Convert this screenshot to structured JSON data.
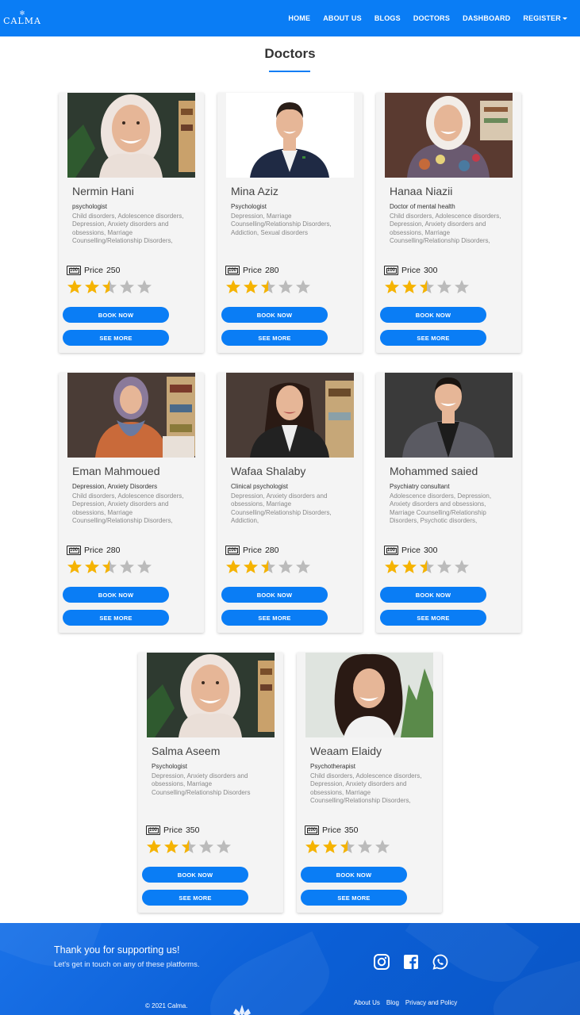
{
  "brand": {
    "name": "CALMA"
  },
  "nav": {
    "items": [
      {
        "label": "HOME"
      },
      {
        "label": "ABOUT US"
      },
      {
        "label": "BLOGS"
      },
      {
        "label": "DOCTORS"
      },
      {
        "label": "DASHBOARD"
      },
      {
        "label": "REGISTER"
      }
    ]
  },
  "page": {
    "title": "Doctors"
  },
  "labels": {
    "book_now": "BOOK NOW",
    "see_more": "SEE MORE",
    "price_prefix": "Price",
    "money_icon_text": "100"
  },
  "doctors": [
    {
      "name": "Nermin Hani",
      "title": "psychologist",
      "specialties": "Child disorders, Adolescence disorders, Depression, Anxiety disorders and obsessions, Marriage Counselling/Relationship Disorders,",
      "price": "250",
      "rating": 2.5,
      "photo": "woman-hijab-light",
      "bg": "#2e3a30"
    },
    {
      "name": "Mina Aziz",
      "title": "Psychologist",
      "specialties": "Depression, Marriage Counselling/Relationship Disorders, Addiction, Sexual disorders",
      "price": "280",
      "rating": 2.5,
      "photo": "man-suit",
      "bg": "#ffffff"
    },
    {
      "name": "Hanaa Niazii",
      "title": "Doctor of mental health",
      "specialties": "Child disorders, Adolescence disorders, Depression, Anxiety disorders and obsessions, Marriage Counselling/Relationship Disorders,",
      "price": "300",
      "rating": 2.5,
      "photo": "woman-hijab-floral",
      "bg": "#5a3a30"
    },
    {
      "name": "Eman Mahmoued",
      "title": "Depression, Anxiety Disorders",
      "specialties": "Child disorders, Adolescence disorders, Depression, Anxiety disorders and obsessions, Marriage Counselling/Relationship Disorders, Sexual disorders",
      "price": "280",
      "rating": 2.5,
      "photo": "woman-hijab-orange",
      "bg": "#4a3c36"
    },
    {
      "name": "Wafaa Shalaby",
      "title": "Clinical psychologist",
      "specialties": "Depression, Anxiety disorders and obsessions, Marriage Counselling/Relationship Disorders, Addiction,",
      "price": "280",
      "rating": 2.5,
      "photo": "woman-dark-hair",
      "bg": "#4a3c36"
    },
    {
      "name": "Mohammed saied",
      "title": "Psychiatry consultant",
      "specialties": "Adolescence disorders, Depression, Anxiety disorders and obsessions, Marriage Counselling/Relationship Disorders, Psychotic disorders, Addiction, Eating disorders, Old age",
      "price": "300",
      "rating": 2.5,
      "photo": "man-blazer",
      "bg": "#3a3a3a"
    },
    {
      "name": "Salma Aseem",
      "title": "Psychologist",
      "specialties": "Depression, Anxiety disorders and obsessions, Marriage Counselling/Relationship Disorders",
      "price": "350",
      "rating": 2.5,
      "photo": "woman-hijab-light",
      "bg": "#2e3a30"
    },
    {
      "name": "Weaam Elaidy",
      "title": "Psychotherapist",
      "specialties": "Child disorders, Adolescence disorders, Depression, Anxiety disorders and obsessions, Marriage Counselling/Relationship Disorders, Psychotic disorders",
      "price": "350",
      "rating": 2.5,
      "photo": "woman-curly-hair",
      "bg": "#dfe4df"
    }
  ],
  "footer": {
    "thanks": "Thank you for supporting us!",
    "touch": "Let's get in touch on any of these platforms.",
    "copyright": "© 2021 Calma.",
    "links": [
      {
        "label": "About Us"
      },
      {
        "label": "Blog"
      },
      {
        "label": "Privacy and Policy"
      }
    ],
    "social": [
      "instagram-icon",
      "facebook-icon",
      "whatsapp-icon"
    ]
  },
  "colors": {
    "primary": "#0a7df5",
    "star": "#f5b301",
    "star_empty": "#bbbbbb",
    "card_bg": "#f4f4f4"
  }
}
